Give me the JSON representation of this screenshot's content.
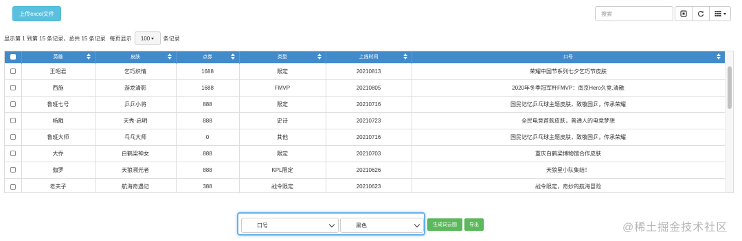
{
  "toolbar": {
    "upload_label": "上传excel文件",
    "search_placeholder": "搜索",
    "refresh_icon": "refresh-icon",
    "toggle_icon": "toggle-view-icon",
    "columns_icon": "columns-grid-icon"
  },
  "pagination": {
    "info_prefix": "显示第 1 到第 15 条记录，总共 15 条记录",
    "per_page_label": "每页显示",
    "page_size": "100",
    "suffix": "条记录"
  },
  "table": {
    "columns": [
      "英雄",
      "皮肤",
      "点券",
      "类型",
      "上线时间",
      "口号"
    ],
    "rows": [
      [
        "王昭君",
        "乞巧织情",
        "1688",
        "限定",
        "20210813",
        "荣耀中国节系列七夕乞巧节皮肤"
      ],
      [
        "西施",
        "游龙清影",
        "1688",
        "FMVP",
        "20210805",
        "2020年冬季冠军杯FMVP：南京Hero久竞.清融"
      ],
      [
        "鲁班七号",
        "乒乒小将",
        "888",
        "限定",
        "20210716",
        "国民记忆乒乓球主题皮肤，致敬国乒，传承荣耀"
      ],
      [
        "杨戬",
        "天秀·启明",
        "888",
        "史诗",
        "20210723",
        "全民电竞首款皮肤，普通人的电竞梦想"
      ],
      [
        "鲁班大师",
        "乓乓大师",
        "0",
        "其他",
        "20210716",
        "国民记忆乒乓球主题皮肤，致敬国乒，传承荣耀"
      ],
      [
        "大乔",
        "白鹤梁神女",
        "888",
        "限定",
        "20210703",
        "重庆白鹤梁博物馆合作皮肤"
      ],
      [
        "伽罗",
        "天狼溯光者",
        "888",
        "KPL限定",
        "20210626",
        "天狼星小队集结！"
      ],
      [
        "老夫子",
        "航海奇遇记",
        "388",
        "战令限定",
        "20210623",
        "战令限定，奇妙的航海冒险"
      ]
    ]
  },
  "controls": {
    "field_select": "口号",
    "color_select": "黑色",
    "wordcloud_label": "生成词云图",
    "export_label": "导出"
  },
  "watermark": "@稀土掘金技术社区",
  "colors": {
    "header_blue": "#428bca",
    "upload_cyan": "#5bc0de",
    "action_green": "#5cb85c",
    "focus_blue": "#66afe9"
  }
}
